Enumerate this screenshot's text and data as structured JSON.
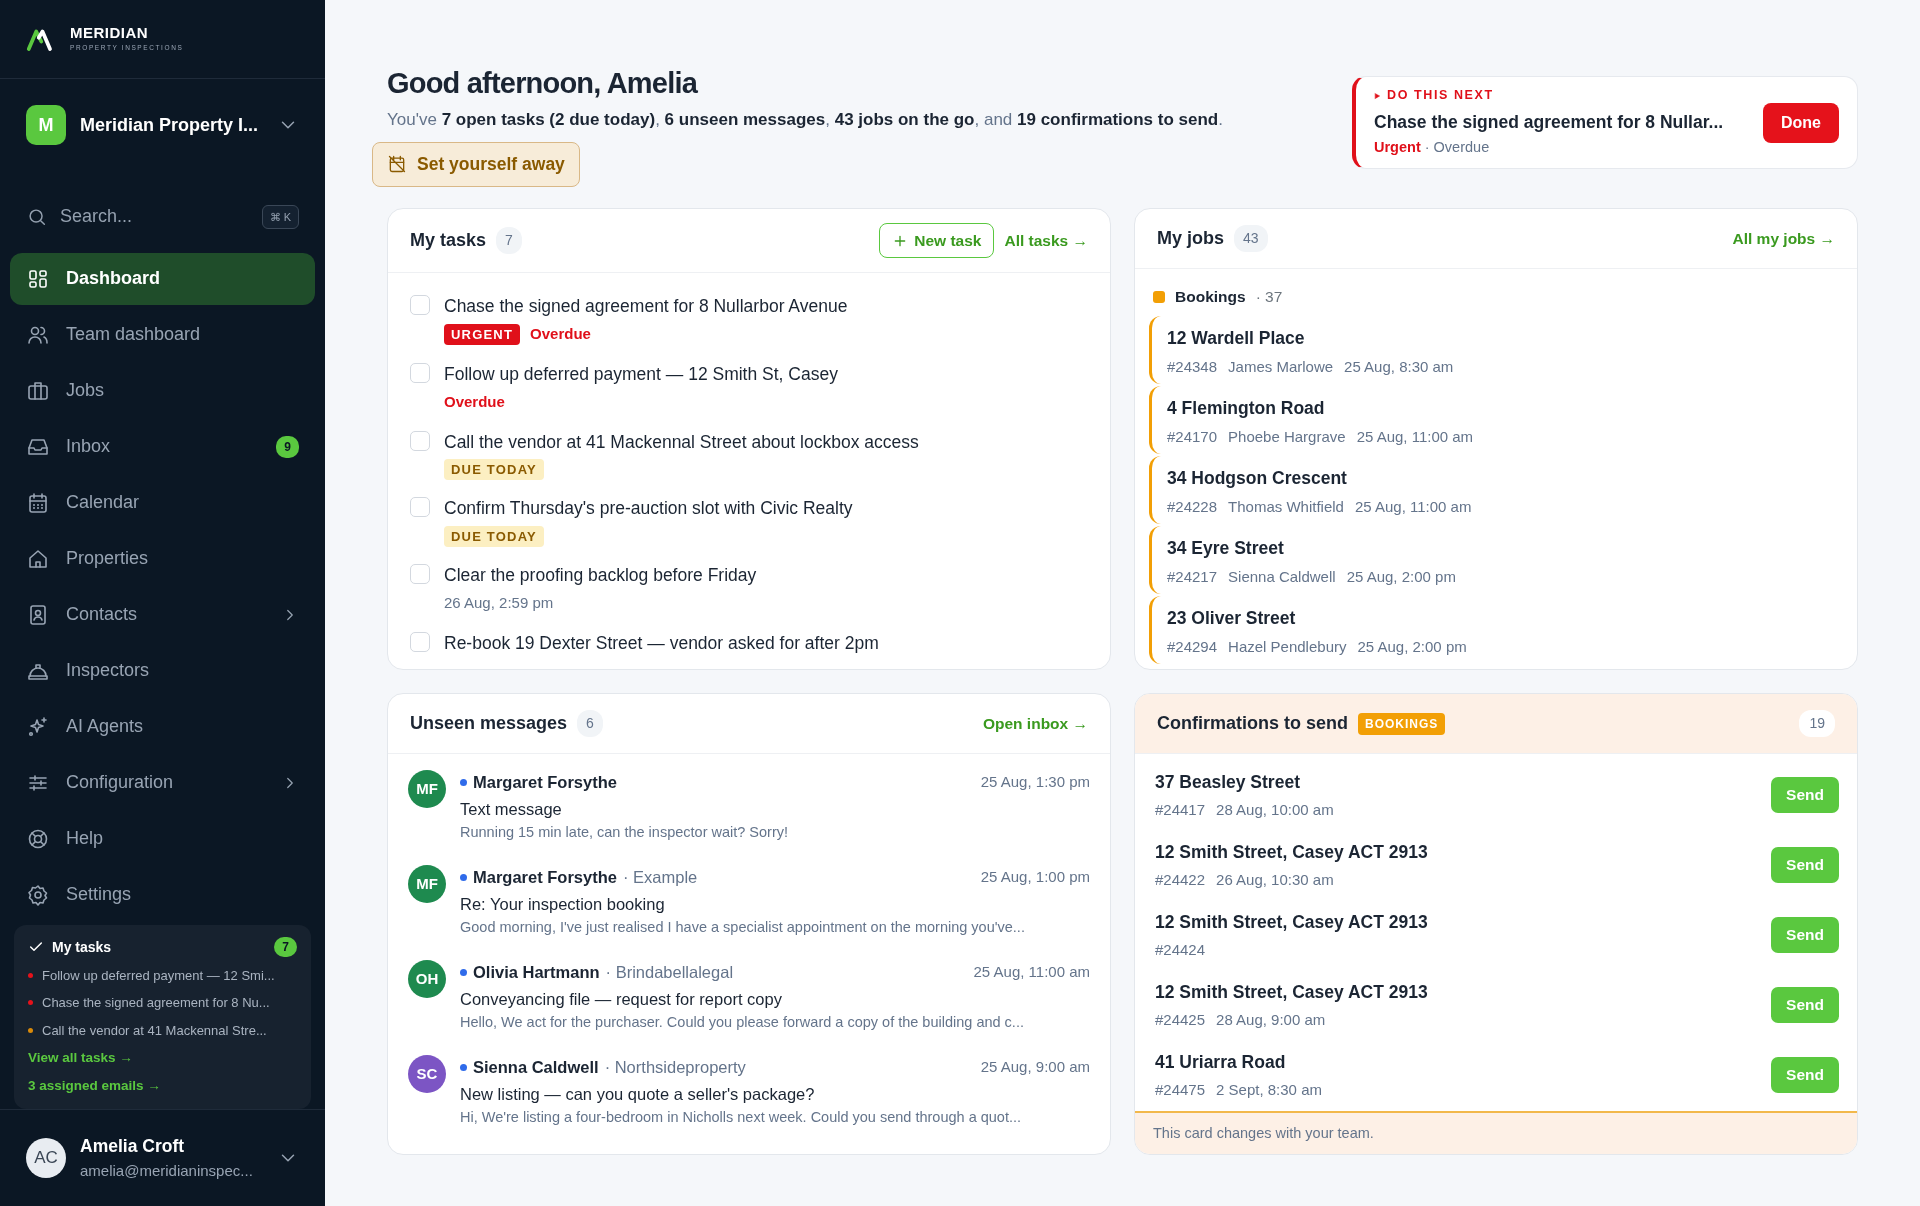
{
  "brand": {
    "name": "MERIDIAN",
    "tagline": "PROPERTY INSPECTIONS"
  },
  "workspace": {
    "initial": "M",
    "name": "Meridian Property I..."
  },
  "search": {
    "placeholder": "Search...",
    "shortcut": "⌘ K"
  },
  "nav": [
    {
      "label": "Dashboard",
      "selected": true,
      "expandable": false
    },
    {
      "label": "Team dashboard",
      "selected": false,
      "expandable": false
    },
    {
      "label": "Jobs",
      "selected": false,
      "expandable": false
    },
    {
      "label": "Inbox",
      "selected": false,
      "expandable": false,
      "badge": "9"
    },
    {
      "label": "Calendar",
      "selected": false,
      "expandable": false
    },
    {
      "label": "Properties",
      "selected": false,
      "expandable": false
    },
    {
      "label": "Contacts",
      "selected": false,
      "expandable": true
    },
    {
      "label": "Inspectors",
      "selected": false,
      "expandable": false
    },
    {
      "label": "AI Agents",
      "selected": false,
      "expandable": false
    },
    {
      "label": "Configuration",
      "selected": false,
      "expandable": true
    },
    {
      "label": "Help",
      "selected": false,
      "expandable": false
    },
    {
      "label": "Settings",
      "selected": false,
      "expandable": false
    }
  ],
  "sidebar_tasks": {
    "title": "My tasks",
    "count": "7",
    "items": [
      {
        "text": "Follow up deferred payment — 12 Smi...",
        "color": "#e5121b"
      },
      {
        "text": "Chase the signed agreement for 8 Nu...",
        "color": "#e5121b"
      },
      {
        "text": "Call the vendor at 41 Mackennal Stre...",
        "color": "#d98a0a"
      }
    ],
    "links": [
      "View all tasks →",
      "3 assigned emails →"
    ]
  },
  "user": {
    "initials": "AC",
    "name": "Amelia Croft",
    "email": "amelia@meridianinspec..."
  },
  "greeting": {
    "title": "Good afternoon, Amelia",
    "summary": "You've **7 open tasks (2 due today)**, **6 unseen messages**, **43 jobs on the go**, and **19 confirmations to send**.",
    "away_button": "Set yourself away"
  },
  "do_next": {
    "label": "DO THIS NEXT",
    "title": "Chase the signed agreement for 8 Nullar...",
    "priority": "Urgent",
    "separator": "·",
    "status": "Overdue",
    "button": "Done"
  },
  "tasks": {
    "title": "My tasks",
    "count": "7",
    "new_button": "New task",
    "link": "All tasks →",
    "items": [
      {
        "title": "Chase the signed agreement for 8 Nullarbor Avenue",
        "checked": false,
        "labels": [
          {
            "kind": "urgent",
            "text": "URGENT"
          },
          {
            "kind": "overdue",
            "text": "Overdue"
          }
        ]
      },
      {
        "title": "Follow up deferred payment — 12 Smith St, Casey",
        "checked": false,
        "labels": [
          {
            "kind": "overdue",
            "text": "Overdue"
          }
        ]
      },
      {
        "title": "Call the vendor at 41 Mackennal Street about lockbox access",
        "checked": false,
        "labels": [
          {
            "kind": "due_today",
            "text": "DUE TODAY"
          }
        ]
      },
      {
        "title": "Confirm Thursday's pre-auction slot with Civic Realty",
        "checked": false,
        "labels": [
          {
            "kind": "due_today",
            "text": "DUE TODAY"
          }
        ]
      },
      {
        "title": "Clear the proofing backlog before Friday",
        "checked": false,
        "labels": [
          {
            "kind": "date",
            "text": "26 Aug, 2:59 pm"
          }
        ]
      },
      {
        "title": "Re-book 19 Dexter Street — vendor asked for after 2pm",
        "checked": false
      }
    ]
  },
  "jobs": {
    "title": "My jobs",
    "count": "43",
    "link": "All my jobs →",
    "group": {
      "name": "Bookings",
      "count": "· 37",
      "color": "#f29f05"
    },
    "items": [
      {
        "address": "12 Wardell Place",
        "ref": "#24348",
        "person": "James Marlowe",
        "time": "25 Aug, 8:30 am"
      },
      {
        "address": "4 Flemington Road",
        "ref": "#24170",
        "person": "Phoebe Hargrave",
        "time": "25 Aug, 11:00 am"
      },
      {
        "address": "34 Hodgson Crescent",
        "ref": "#24228",
        "person": "Thomas Whitfield",
        "time": "25 Aug, 11:00 am"
      },
      {
        "address": "34 Eyre Street",
        "ref": "#24217",
        "person": "Sienna Caldwell",
        "time": "25 Aug, 2:00 pm"
      },
      {
        "address": "23 Oliver Street",
        "ref": "#24294",
        "person": "Hazel Pendlebury",
        "time": "25 Aug, 2:00 pm"
      }
    ]
  },
  "messages": {
    "title": "Unseen messages",
    "count": "6",
    "link": "Open inbox →",
    "items": [
      {
        "initials": "MF",
        "color": "#1e8a4f",
        "unread": true,
        "sender": "Margaret Forsythe",
        "time": "25 Aug, 1:30 pm",
        "subject": "Text message",
        "preview": "Running 15 min late, can the inspector wait? Sorry!"
      },
      {
        "initials": "MF",
        "color": "#1e8a4f",
        "unread": true,
        "sender": "Margaret Forsythe",
        "org": "· Example",
        "time": "25 Aug, 1:00 pm",
        "subject": "Re: Your inspection booking",
        "preview": "Good morning, I've just realised I have a specialist appointment on the morning you've..."
      },
      {
        "initials": "OH",
        "color": "#1e8a4f",
        "unread": true,
        "sender": "Olivia Hartmann",
        "org": "· Brindabellalegal",
        "time": "25 Aug, 11:00 am",
        "subject": "Conveyancing file — request for report copy",
        "preview": "Hello, We act for the purchaser. Could you please forward a copy of the building and c..."
      },
      {
        "initials": "SC",
        "color": "#7c55c4",
        "unread": true,
        "sender": "Sienna Caldwell",
        "org": "· Northsideproperty",
        "time": "25 Aug, 9:00 am",
        "subject": "New listing — can you quote a seller's package?",
        "preview": "Hi, We're listing a four-bedroom in Nicholls next week. Could you send through a quot..."
      }
    ]
  },
  "confirmations": {
    "title": "Confirmations to send",
    "tag": "BOOKINGS",
    "count": "19",
    "footer": "This card changes with your team.",
    "items": [
      {
        "address": "37 Beasley Street",
        "ref": "#24417",
        "time": "28 Aug, 10:00 am",
        "button": "Send"
      },
      {
        "address": "12 Smith Street, Casey ACT 2913",
        "ref": "#24422",
        "time": "26 Aug, 10:30 am",
        "button": "Send"
      },
      {
        "address": "12 Smith Street, Casey ACT 2913",
        "ref": "#24424",
        "button": "Send"
      },
      {
        "address": "12 Smith Street, Casey ACT 2913",
        "ref": "#24425",
        "time": "28 Aug, 9:00 am",
        "button": "Send"
      },
      {
        "address": "41 Uriarra Road",
        "ref": "#24475",
        "time": "2 Sept, 8:30 am",
        "button": "Send"
      }
    ]
  }
}
